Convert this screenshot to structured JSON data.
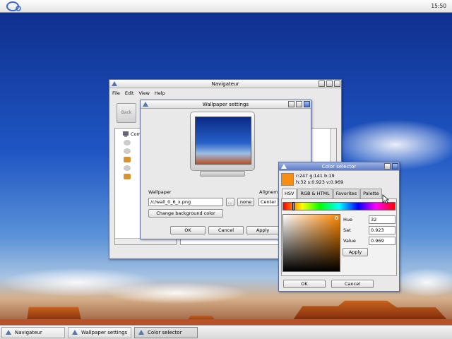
{
  "desktop": {
    "clock": "15:50"
  },
  "navigator": {
    "title": "Navigateur",
    "menu": [
      "File",
      "Edit",
      "View",
      "Help"
    ],
    "back_label": "Back",
    "tree_root_label": "Com"
  },
  "wallpaper": {
    "title": "Wallpaper settings",
    "wallpaper_label": "Wallpaper",
    "path_value": "/c/wall_0_6_x.png",
    "browse_label": "...",
    "none_label": "none",
    "alignment_label": "Alignement",
    "alignment_value": "Center",
    "change_color_label": "Change background color",
    "ok_label": "OK",
    "cancel_label": "Cancel",
    "apply_label": "Apply"
  },
  "color_selector": {
    "title": "Color selector",
    "swatch_color": "#f78d13",
    "rgb_text": "r:247 g:141 b:19",
    "hsv_text": "h:32 s:0.923 v:0.969",
    "tabs": [
      "HSV",
      "RGB & HTML",
      "Favorites",
      "Palette"
    ],
    "hue_label": "Hue",
    "hue_value": "32",
    "sat_label": "Sat",
    "sat_value": "0.923",
    "value_label": "Value",
    "value_value": "0.969",
    "apply_label": "Apply",
    "ok_label": "OK",
    "cancel_label": "Cancel"
  },
  "taskbar": {
    "items": [
      "Navigateur",
      "Wallpaper settings",
      "Color selector"
    ]
  },
  "colors": {
    "title_active": "#5d7cc6",
    "window_bg": "#e9e9e9",
    "accent_orange": "#f78d13"
  }
}
